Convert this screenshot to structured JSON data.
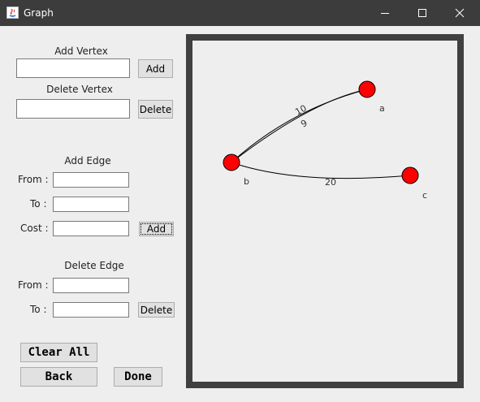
{
  "window": {
    "title": "Graph"
  },
  "add_vertex": {
    "heading": "Add Vertex",
    "input_value": "",
    "button": "Add"
  },
  "delete_vertex": {
    "heading": "Delete Vertex",
    "input_value": "",
    "button": "Delete"
  },
  "add_edge": {
    "heading": "Add Edge",
    "from_label": "From :",
    "to_label": "To :",
    "cost_label": "Cost :",
    "button": "Add"
  },
  "delete_edge": {
    "heading": "Delete Edge",
    "from_label": "From :",
    "to_label": "To :",
    "button": "Delete"
  },
  "actions": {
    "clear_all": "Clear All",
    "back": "Back",
    "done": "Done"
  },
  "graph": {
    "vertex_color": "#ff0000",
    "vertices": [
      {
        "id": "a"
      },
      {
        "id": "b"
      },
      {
        "id": "c"
      }
    ],
    "edges": [
      {
        "from": "b",
        "to": "a",
        "cost": "10"
      },
      {
        "from": "b",
        "to": "a",
        "cost": "9"
      },
      {
        "from": "b",
        "to": "c",
        "cost": "20"
      }
    ]
  }
}
